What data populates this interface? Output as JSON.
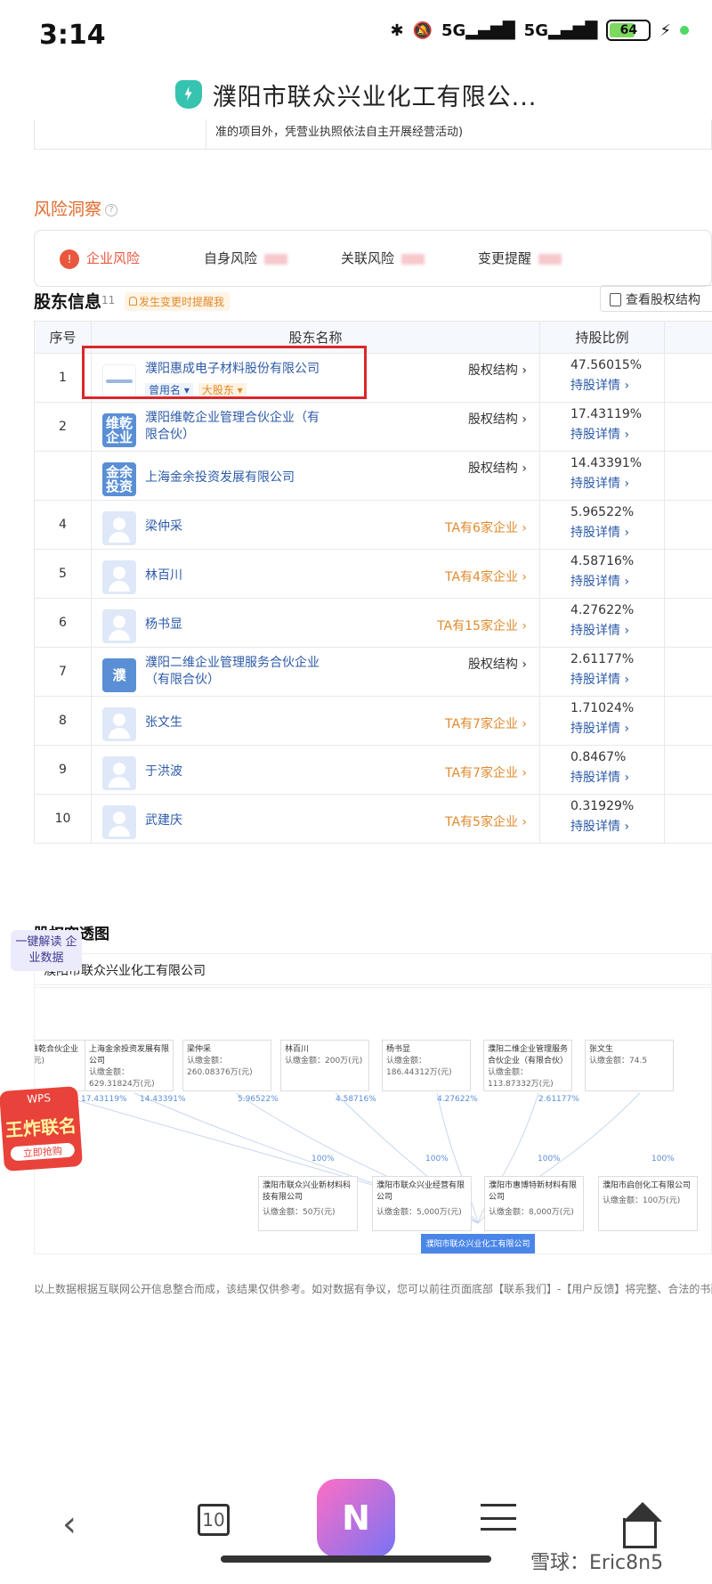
{
  "status_bar": {
    "time": "3:14",
    "battery": "64",
    "signal1": "5G",
    "signal2": "5G"
  },
  "header": {
    "title": "濮阳市联众兴业化工有限公..."
  },
  "business_scope_fragment": "准的项目外，凭营业执照依法自主开展经营活动)",
  "risk": {
    "title": "风险洞察",
    "help_icon": "?",
    "items": [
      {
        "label": "企业风险"
      },
      {
        "label": "自身风险"
      },
      {
        "label": "关联风险"
      },
      {
        "label": "变更提醒"
      }
    ]
  },
  "shareholders": {
    "title": "股东信息",
    "count": "11",
    "remind_label": "发生变更时提醒我",
    "equity_button": "查看股权结构",
    "columns": [
      "序号",
      "股东名称",
      "持股比例"
    ],
    "detail_label": "持股详情 ›",
    "rows": [
      {
        "idx": "1",
        "name": "濮阳惠成电子材料股份有限公司",
        "avatar": "",
        "tag1": "曾用名 ▾",
        "tag2": "大股东 ▾",
        "link": "股权结构 ›",
        "ratio": "47.56015%"
      },
      {
        "idx": "2",
        "name": "濮阳维乾企业管理合伙企业（有限合伙）",
        "avatar": "维乾企业",
        "link": "股权结构 ›",
        "ratio": "17.43119%"
      },
      {
        "idx": "",
        "name": "上海金余投资发展有限公司",
        "avatar": "金余投资",
        "link": "股权结构 ›",
        "ratio": "14.43391%"
      },
      {
        "idx": "4",
        "name": "梁仲采",
        "avatar": "",
        "link": "TA有6家企业 ›",
        "ratio": "5.96522%"
      },
      {
        "idx": "5",
        "name": "林百川",
        "avatar": "",
        "link": "TA有4家企业 ›",
        "ratio": "4.58716%"
      },
      {
        "idx": "6",
        "name": "杨书显",
        "avatar": "",
        "link": "TA有15家企业 ›",
        "ratio": "4.27622%"
      },
      {
        "idx": "7",
        "name": "濮阳二维企业管理服务合伙企业（有限合伙）",
        "avatar": "濮",
        "link": "股权结构 ›",
        "ratio": "2.61177%"
      },
      {
        "idx": "8",
        "name": "张文生",
        "avatar": "",
        "link": "TA有7家企业 ›",
        "ratio": "1.71024%"
      },
      {
        "idx": "9",
        "name": "于洪波",
        "avatar": "",
        "link": "TA有7家企业 ›",
        "ratio": "0.8467%"
      },
      {
        "idx": "10",
        "name": "武建庆",
        "avatar": "",
        "link": "TA有5家企业 ›",
        "ratio": "0.31929%"
      }
    ]
  },
  "penetration": {
    "title": "股权穿透图",
    "company": "濮阳市联众兴业化工有限公司",
    "side_button": "一键解读 企业数据",
    "top_nodes": [
      {
        "name": "维乾合伙企业",
        "sub": "(元)",
        "pct": "17.43119%"
      },
      {
        "name": "上海金余投资发展有限公司",
        "sub": "认缴金额：629.31824万(元)",
        "pct": "14.43391%"
      },
      {
        "name": "梁仲采",
        "sub": "认缴金额：260.08376万(元)",
        "pct": "5.96522%"
      },
      {
        "name": "林百川",
        "sub": "认缴金额：200万(元)",
        "pct": "4.58716%"
      },
      {
        "name": "杨书显",
        "sub": "认缴金额：186.44312万(元)",
        "pct": "4.27622%"
      },
      {
        "name": "濮阳二维企业管理服务合伙企业（有限合伙）",
        "sub": "认缴金额：113.87332万(元)",
        "pct": "2.61177%"
      },
      {
        "name": "张文生",
        "sub": "认缴金额：74.5",
        "pct": ""
      }
    ],
    "center": "濮阳市联众兴业化工有限公司",
    "bottom_nodes": [
      {
        "name": "濮阳市联众兴业新材料科技有限公司",
        "sub": "认缴金额：50万(元)",
        "pct": "100%"
      },
      {
        "name": "濮阳市联众兴业经营有限公司",
        "sub": "认缴金额：5,000万(元)",
        "pct": "100%"
      },
      {
        "name": "濮阳市惠博特新材料有限公司",
        "sub": "认缴金额：8,000万(元)",
        "pct": "100%"
      },
      {
        "name": "濮阳市启创化工有限公司",
        "sub": "认缴金额：100万(元)",
        "pct": "100%"
      }
    ]
  },
  "promo": {
    "line1": "WPS",
    "line2": "王炸联名",
    "line3": "立即抢购"
  },
  "footnote": "以上数据根据互联网公开信息整合而成，该结果仅供参考。如对数据有争议，您可以前往页面底部【联系我们】-【用户反馈】将完整、合法的书面权利",
  "nav": {
    "tabs_count": "10",
    "ai_label": "N",
    "watermark": "雪球：Eric8n5"
  }
}
